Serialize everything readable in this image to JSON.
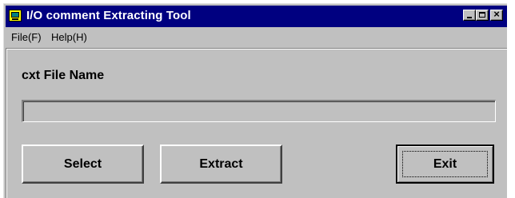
{
  "window": {
    "title": "I/O comment Extracting Tool",
    "icon": "monitor-app-icon",
    "controls": {
      "minimize": "minimize-icon",
      "maximize": "maximize-icon",
      "close": "×"
    }
  },
  "menu": {
    "items": [
      {
        "label": "File(F)",
        "name": "menu-file"
      },
      {
        "label": "Help(H)",
        "name": "menu-help"
      }
    ]
  },
  "form": {
    "file_label": "cxt File Name",
    "file_value": ""
  },
  "buttons": {
    "select": "Select",
    "extract": "Extract",
    "exit": "Exit"
  },
  "colors": {
    "titlebar": "#000080",
    "face": "#c0c0c0"
  }
}
